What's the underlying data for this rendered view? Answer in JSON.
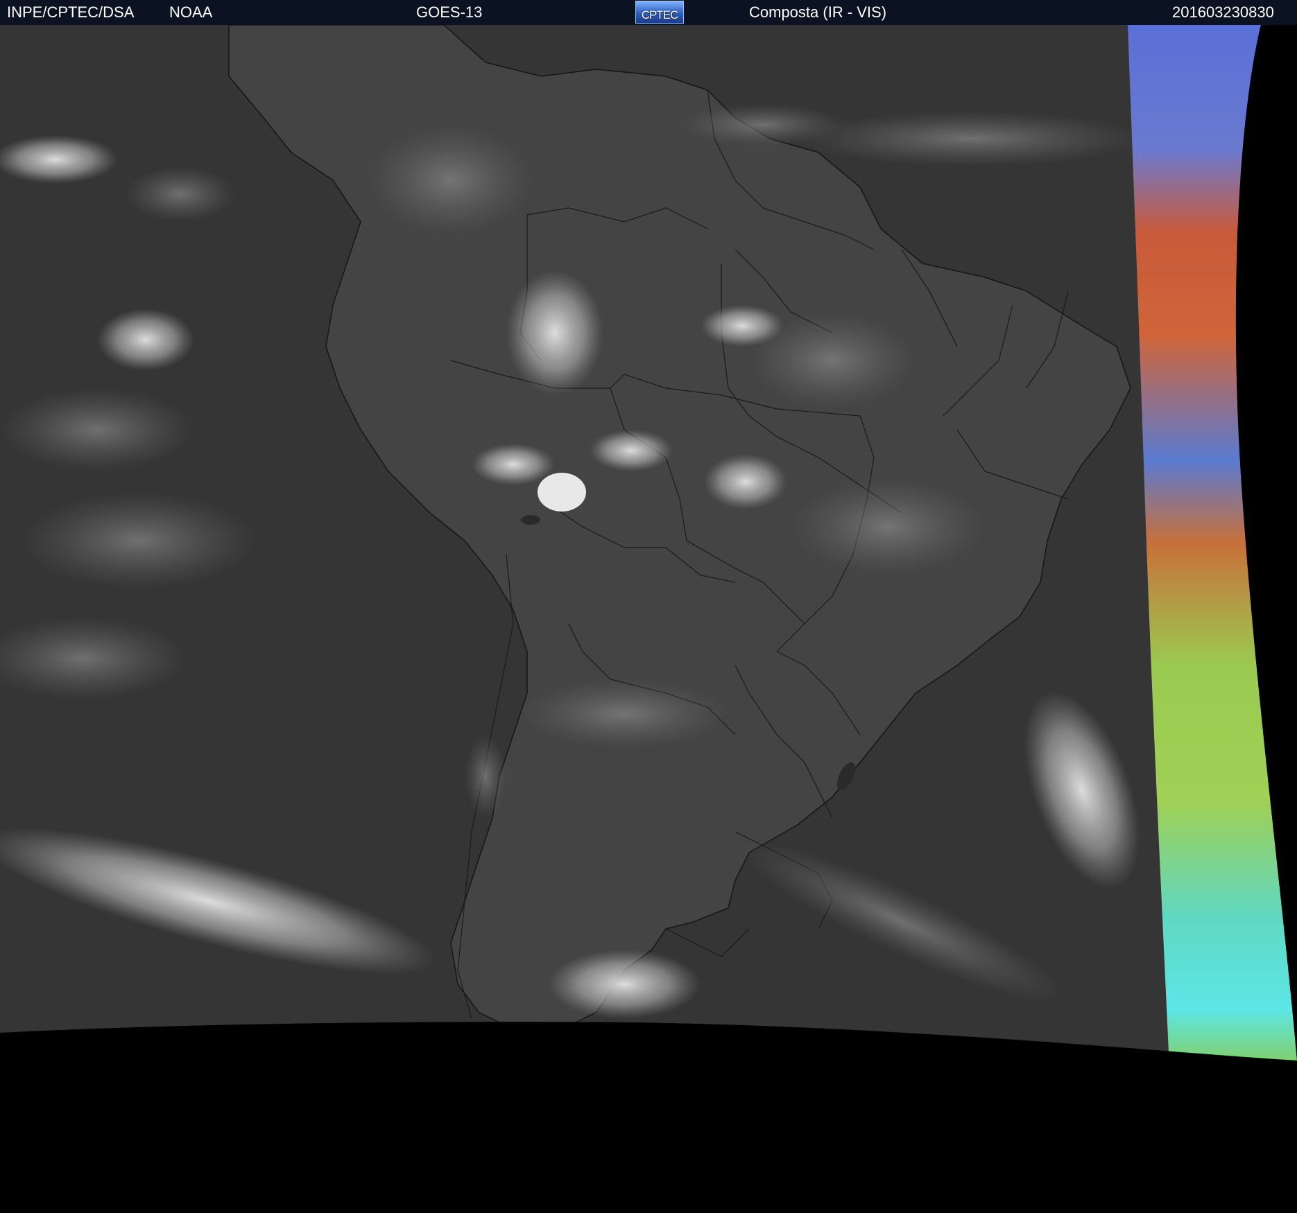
{
  "header": {
    "left_label": "INPE/CPTEC/DSA",
    "agency": "NOAA",
    "satellite": "GOES-13",
    "logo_text": "CPTEC",
    "product": "Composta (IR - VIS)",
    "timestamp": "201603230830"
  },
  "colors": {
    "header_bg": "#0b1322",
    "header_text": "#ffffff",
    "ocean": "#3a3a3a",
    "land": "#444444",
    "cloud": "#d8d8d8",
    "space": "#000000"
  }
}
